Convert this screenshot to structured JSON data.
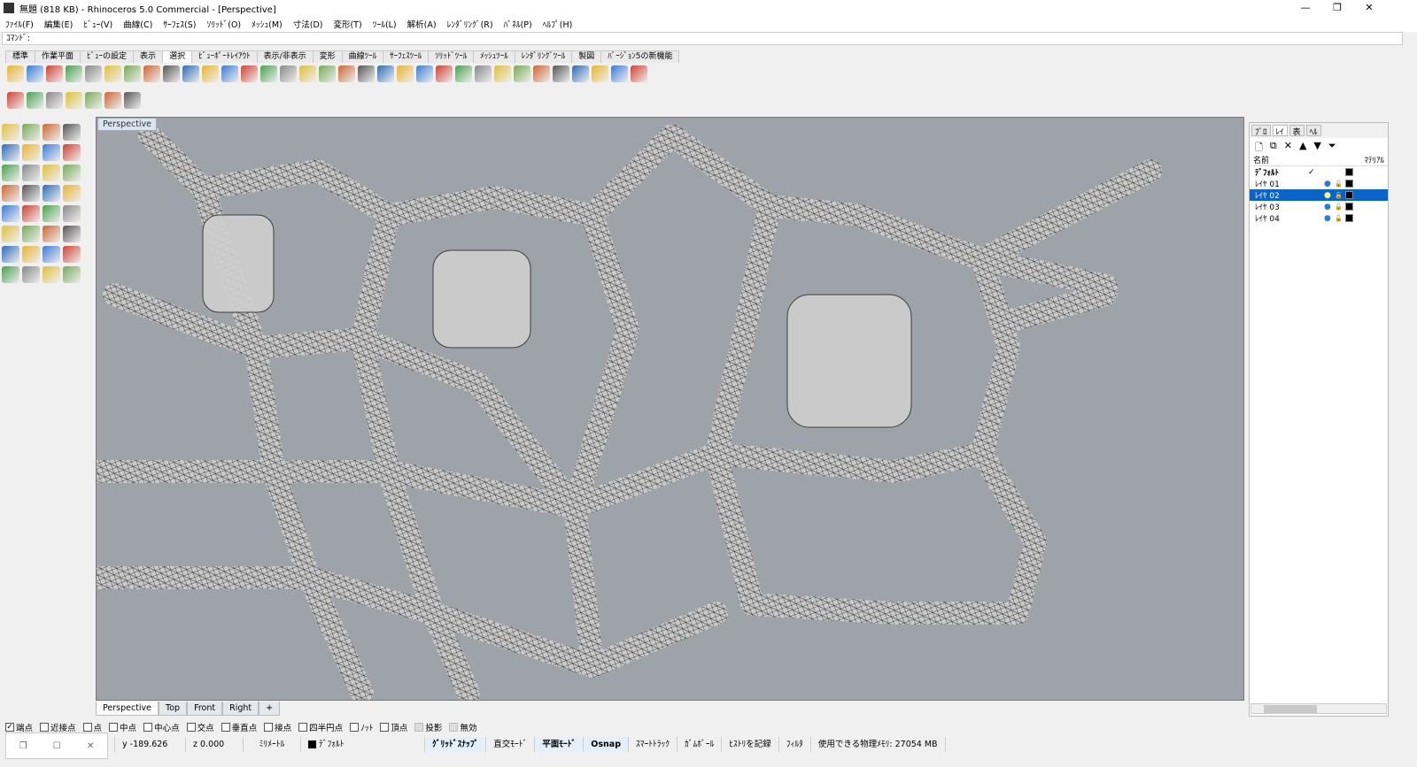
{
  "title": "無題 (818 KB) - Rhinoceros 5.0 Commercial - [Perspective]",
  "window_controls": {
    "minimize": "—",
    "restore": "❐",
    "close": "✕"
  },
  "menu": [
    "ﾌｧｲﾙ(F)",
    "編集(E)",
    "ﾋﾞｭｰ(V)",
    "曲線(C)",
    "ｻｰﾌｪｽ(S)",
    "ｿﾘｯﾄﾞ(O)",
    "ﾒｯｼｭ(M)",
    "寸法(D)",
    "変形(T)",
    "ﾂｰﾙ(L)",
    "解析(A)",
    "ﾚﾝﾀﾞﾘﾝｸﾞ(R)",
    "ﾊﾟﾈﾙ(P)",
    "ﾍﾙﾌﾟ(H)"
  ],
  "command": {
    "label": "ｺﾏﾝﾄﾞ:",
    "value": ""
  },
  "toolbar_tabs": [
    "標準",
    "作業平面",
    "ﾋﾞｭｰの設定",
    "表示",
    "選択",
    "ﾋﾞｭｰﾎﾟｰﾄﾚｲｱｳﾄ",
    "表示/非表示",
    "変形",
    "曲線ﾂｰﾙ",
    "ｻｰﾌｪｽﾂｰﾙ",
    "ｿﾘｯﾄﾞﾂｰﾙ",
    "ﾒｯｼｭﾂｰﾙ",
    "ﾚﾝﾀﾞﾘﾝｸﾞﾂｰﾙ",
    "製図",
    "ﾊﾞｰｼﾞｮﾝ5の新機能"
  ],
  "active_tab": "選択",
  "viewport": {
    "label": "Perspective",
    "tabs": [
      "Perspective",
      "Top",
      "Front",
      "Right"
    ],
    "add_tab": "+"
  },
  "panel": {
    "tabs": [
      "ﾌﾟﾛ",
      "ﾚｲ",
      "表",
      "ﾍﾙ"
    ],
    "columns": {
      "name": "名前",
      "material": "ﾏﾃﾘｱﾙ"
    },
    "layers": [
      {
        "name": "ﾃﾞﾌｫﾙﾄ",
        "current": "✓",
        "bold": true
      },
      {
        "name": "ﾚｲﾔ 01"
      },
      {
        "name": "ﾚｲﾔ 02",
        "selected": true
      },
      {
        "name": "ﾚｲﾔ 03"
      },
      {
        "name": "ﾚｲﾔ 04"
      }
    ]
  },
  "osnap": [
    {
      "label": "端点",
      "checked": true
    },
    {
      "label": "近接点"
    },
    {
      "label": "点"
    },
    {
      "label": "中点"
    },
    {
      "label": "中心点"
    },
    {
      "label": "交点"
    },
    {
      "label": "垂直点"
    },
    {
      "label": "接点"
    },
    {
      "label": "四半円点"
    },
    {
      "label": "ﾉｯﾄ"
    },
    {
      "label": "頂点"
    },
    {
      "label": "投影",
      "disabled": true
    },
    {
      "label": "無効",
      "disabled": true
    }
  ],
  "status": {
    "y": "y -189.626",
    "z": "z 0.000",
    "units": "ﾐﾘﾒｰﾄﾙ",
    "layer": "ﾃﾞﾌｫﾙﾄ",
    "toggles": [
      {
        "label": "ｸﾞﾘｯﾄﾞｽﾅｯﾌﾟ",
        "on": true
      },
      {
        "label": "直交ﾓｰﾄﾞ"
      },
      {
        "label": "平面ﾓｰﾄﾞ",
        "on": true
      },
      {
        "label": "Osnap",
        "on": true
      },
      {
        "label": "ｽﾏｰﾄﾄﾗｯｸ"
      },
      {
        "label": "ｶﾞﾑﾎﾞｰﾙ"
      },
      {
        "label": "ﾋｽﾄﾘを記録"
      },
      {
        "label": "ﾌｨﾙﾀ"
      }
    ],
    "memory": "使用できる物理ﾒﾓﾘ: 27054 MB"
  },
  "colors": {
    "selection": "#0a64c8",
    "viewport_bg": "#9ea3aa"
  }
}
